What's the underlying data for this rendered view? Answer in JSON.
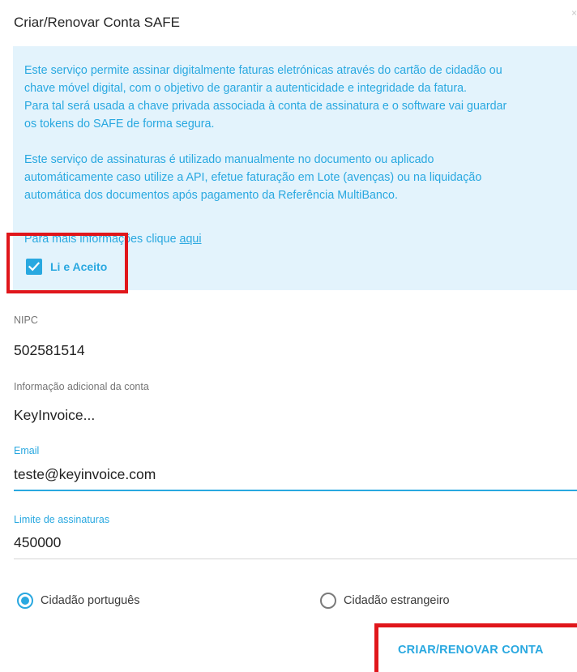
{
  "dialog": {
    "title": "Criar/Renovar Conta SAFE",
    "close_glyph": "×"
  },
  "info": {
    "paragraph_1_line_1": "Este serviço permite assinar digitalmente faturas eletrónicas através do cartão de cidadão ou",
    "paragraph_1_line_2": "chave móvel digital, com o objetivo de garantir a autenticidade e integridade da fatura.",
    "paragraph_1_line_3": "Para tal será usada a chave privada associada à conta de assinatura e o software vai guardar",
    "paragraph_1_line_4": "os tokens do SAFE de forma segura.",
    "paragraph_2_line_1": "Este serviço de assinaturas é utilizado manualmente no documento ou aplicado",
    "paragraph_2_line_2": "automáticamente caso utilize a API, efetue faturação em Lote (avenças) ou na liquidação",
    "paragraph_2_line_3": "automática dos documentos após pagamento da Referência MultiBanco.",
    "more_info_text": "Para mais informações clique ",
    "more_info_link": "aqui"
  },
  "accept": {
    "label": "Li e Aceito",
    "checked": true
  },
  "fields": {
    "nipc": {
      "label": "NIPC",
      "value": "502581514"
    },
    "additional_info": {
      "label": "Informação adicional da conta",
      "value": "KeyInvoice..."
    },
    "email": {
      "label": "Email",
      "value": "teste@keyinvoice.com"
    },
    "signature_limit": {
      "label": "Limite de assinaturas",
      "value": "450000"
    }
  },
  "citizenship": {
    "options": [
      {
        "label": "Cidadão português",
        "selected": true
      },
      {
        "label": "Cidadão estrangeiro",
        "selected": false
      }
    ]
  },
  "actions": {
    "submit_label": "CRIAR/RENOVAR CONTA"
  },
  "colors": {
    "accent": "#29a8e0",
    "info_background": "#e3f3fc",
    "highlight_red": "#e0161b"
  },
  "icons": {
    "checkbox": "check-icon",
    "radio_selected": "radio-checked-icon",
    "radio_unselected": "radio-unchecked-icon"
  }
}
